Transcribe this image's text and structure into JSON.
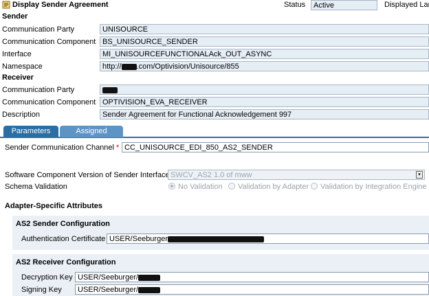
{
  "header": {
    "title": "Display Sender Agreement",
    "status_label": "Status",
    "status_value": "Active",
    "displayed_lang_label": "Displayed Lar"
  },
  "sender": {
    "section_title": "Sender",
    "party_label": "Communication Party",
    "party_value": "UNISOURCE",
    "component_label": "Communication Component",
    "component_value": "BS_UNISOURCE_SENDER",
    "interface_label": "Interface",
    "interface_value": "MI_UNISOURCEFUNCTIONALAck_OUT_ASYNC",
    "namespace_label": "Namespace",
    "namespace_prefix": "http://",
    "namespace_suffix": ".com/Optivision/Unisource/855"
  },
  "receiver": {
    "section_title": "Receiver",
    "party_label": "Communication Party",
    "component_label": "Communication Component",
    "component_value": "OPTIVISION_EVA_RECEIVER",
    "description_label": "Description",
    "description_value": "Sender Agreement for Functional Acknowledgement 997"
  },
  "tabs": [
    {
      "label": "Parameters",
      "active": true
    },
    {
      "label": "Assigned Users",
      "active": false
    }
  ],
  "parameters": {
    "channel_label": "Sender Communication Channel",
    "channel_required": "*",
    "channel_value": "CC_UNISOURCE_EDI_850_AS2_SENDER",
    "swcv_label": "Software Component Version of Sender Interface",
    "swcv_value": "SWCV_AS2 1.0 of mww",
    "schema_label": "Schema Validation",
    "schema_options": [
      "No Validation",
      "Validation by Adapter",
      "Validation by Integration Engine"
    ],
    "schema_selected": "No Validation"
  },
  "adapter": {
    "section_title": "Adapter-Specific Attributes",
    "as2_sender_title": "AS2 Sender Configuration",
    "auth_cert_label": "Authentication Certificate",
    "auth_cert_value": "USER/Seeburger",
    "as2_receiver_title": "AS2 Receiver Configuration",
    "decryption_label": "Decryption Key",
    "decryption_value": "USER/Seeburger/",
    "signing_label": "Signing Key",
    "signing_value": "USER/Seeburger/"
  },
  "colors": {
    "tab_active": "#2b6ea4",
    "tab_inactive": "#5d94c6",
    "field_bg": "#e5edf5",
    "panel_bg": "#eaf0f5"
  }
}
